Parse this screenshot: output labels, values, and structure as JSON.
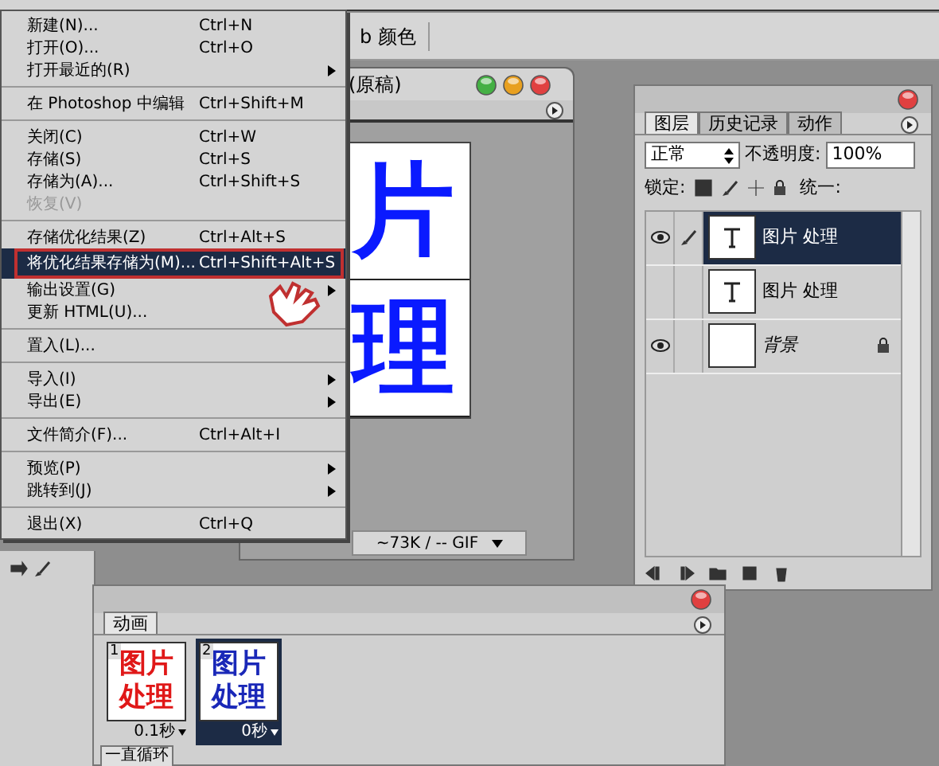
{
  "options_bar": {
    "label": "b 颜色"
  },
  "document": {
    "title": "(原稿)",
    "canvas_chars": [
      "片",
      "理"
    ],
    "status": "~73K / -- GIF"
  },
  "file_menu": {
    "groups": [
      [
        {
          "label": "新建(N)...",
          "shortcut": "Ctrl+N",
          "submenu": false,
          "disabled": false,
          "selected": false
        },
        {
          "label": "打开(O)...",
          "shortcut": "Ctrl+O",
          "submenu": false,
          "disabled": false,
          "selected": false
        },
        {
          "label": "打开最近的(R)",
          "submenu": true,
          "disabled": false,
          "selected": false
        }
      ],
      [
        {
          "label": "在 Photoshop 中编辑",
          "shortcut": "Ctrl+Shift+M",
          "submenu": false,
          "disabled": false,
          "selected": false
        }
      ],
      [
        {
          "label": "关闭(C)",
          "shortcut": "Ctrl+W",
          "submenu": false,
          "disabled": false,
          "selected": false
        },
        {
          "label": "存储(S)",
          "shortcut": "Ctrl+S",
          "submenu": false,
          "disabled": false,
          "selected": false
        },
        {
          "label": "存储为(A)...",
          "shortcut": "Ctrl+Shift+S",
          "submenu": false,
          "disabled": false,
          "selected": false
        },
        {
          "label": "恢复(V)",
          "submenu": false,
          "disabled": true,
          "selected": false
        }
      ],
      [
        {
          "label": "存储优化结果(Z)",
          "shortcut": "Ctrl+Alt+S",
          "submenu": false,
          "disabled": false,
          "selected": false
        },
        {
          "label": "将优化结果存储为(M)...",
          "shortcut": "Ctrl+Shift+Alt+S",
          "submenu": false,
          "disabled": false,
          "selected": true
        },
        {
          "label": "输出设置(G)",
          "submenu": true,
          "disabled": false,
          "selected": false
        },
        {
          "label": "更新 HTML(U)...",
          "submenu": false,
          "disabled": false,
          "selected": false
        }
      ],
      [
        {
          "label": "置入(L)...",
          "submenu": false,
          "disabled": false,
          "selected": false
        }
      ],
      [
        {
          "label": "导入(I)",
          "submenu": true,
          "disabled": false,
          "selected": false
        },
        {
          "label": "导出(E)",
          "submenu": true,
          "disabled": false,
          "selected": false
        }
      ],
      [
        {
          "label": "文件简介(F)...",
          "shortcut": "Ctrl+Alt+I",
          "submenu": false,
          "disabled": false,
          "selected": false
        }
      ],
      [
        {
          "label": "预览(P)",
          "submenu": true,
          "disabled": false,
          "selected": false
        },
        {
          "label": "跳转到(J)",
          "submenu": true,
          "disabled": false,
          "selected": false
        }
      ],
      [
        {
          "label": "退出(X)",
          "shortcut": "Ctrl+Q",
          "submenu": false,
          "disabled": false,
          "selected": false
        }
      ]
    ]
  },
  "layers_panel": {
    "tabs": [
      {
        "label": "图层",
        "selected": true
      },
      {
        "label": "历史记录",
        "selected": false
      },
      {
        "label": "动作",
        "selected": false
      }
    ],
    "blend_mode": "正常",
    "opacity_label": "不透明度:",
    "opacity": "100%",
    "lock_label": "锁定:",
    "unify_label": "统一:",
    "layers": [
      {
        "name": "图片 处理",
        "kind": "text",
        "visible": true,
        "linked": true,
        "locked": false,
        "selected": true
      },
      {
        "name": "图片 处理",
        "kind": "text",
        "visible": false,
        "linked": false,
        "locked": false,
        "selected": false
      },
      {
        "name": "背景",
        "kind": "background",
        "visible": true,
        "linked": false,
        "locked": true,
        "selected": false
      }
    ]
  },
  "animation_panel": {
    "tab": "动画",
    "frames": [
      {
        "number": "1",
        "lines": [
          "图片",
          "处理"
        ],
        "color": "#e01818",
        "delay": "0.1秒",
        "selected": false
      },
      {
        "number": "2",
        "lines": [
          "图片",
          "处理"
        ],
        "color": "#1a28b8",
        "delay": "0秒",
        "selected": true
      }
    ],
    "loop": "一直循环"
  }
}
